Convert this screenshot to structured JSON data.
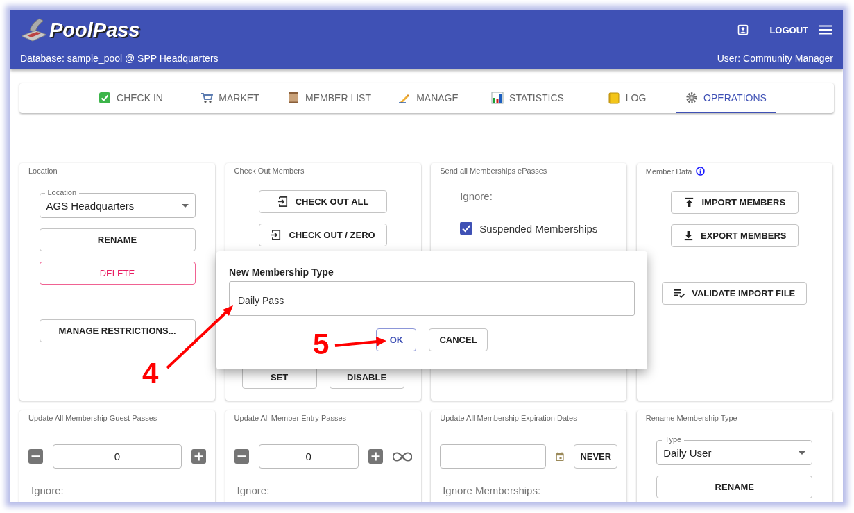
{
  "app": {
    "title": "PoolPass",
    "database": "Database: sample_pool @ SPP Headquarters",
    "user": "User: Community Manager",
    "logout": "LOGOUT"
  },
  "tabs": [
    {
      "label": "CHECK IN",
      "selected": false
    },
    {
      "label": "MARKET",
      "selected": false
    },
    {
      "label": "MEMBER LIST",
      "selected": false
    },
    {
      "label": "MANAGE",
      "selected": false
    },
    {
      "label": "STATISTICS",
      "selected": false
    },
    {
      "label": "LOG",
      "selected": false
    },
    {
      "label": "OPERATIONS",
      "selected": true
    }
  ],
  "cards": [
    {
      "title": "Location",
      "has_info": false,
      "sections": [
        [
          {
            "kind": "select",
            "label": "Location",
            "value": "AGS Headquarters"
          },
          {
            "kind": "button",
            "label": "RENAME"
          },
          {
            "kind": "danger",
            "label": "DELETE"
          }
        ],
        [
          {
            "kind": "button",
            "label": "MANAGE RESTRICTIONS..."
          }
        ]
      ]
    },
    {
      "title": "Check Out Members",
      "has_info": false,
      "sections": [
        [
          {
            "kind": "exit",
            "label": "CHECK OUT ALL"
          },
          {
            "kind": "exit",
            "label": "CHECK OUT / ZERO"
          }
        ],
        [
          {
            "kind": "button-row",
            "buttons": [
              "SET",
              "DISABLE"
            ]
          }
        ]
      ]
    },
    {
      "title": "Send all Memberships ePasses",
      "has_info": false,
      "sections": [
        [
          {
            "kind": "label",
            "text": "Ignore:"
          },
          {
            "kind": "checkbox",
            "label": "Suspended Memberships",
            "checked": true
          }
        ]
      ]
    },
    {
      "title": "Member Data",
      "has_info": true,
      "sections": [
        [
          {
            "kind": "upload",
            "label": "IMPORT MEMBERS"
          },
          {
            "kind": "download",
            "label": "EXPORT MEMBERS"
          }
        ],
        [
          {
            "kind": "validate",
            "label": "VALIDATE IMPORT FILE"
          }
        ]
      ]
    },
    {
      "title": "Update All Membership Guest Passes",
      "has_info": false,
      "sections": [
        [
          {
            "kind": "stepper",
            "value": "0",
            "unlimited": false
          },
          {
            "kind": "label",
            "text": "Ignore:"
          }
        ]
      ]
    },
    {
      "title": "Update All Member Entry Passes",
      "has_info": false,
      "sections": [
        [
          {
            "kind": "stepper",
            "value": "0",
            "unlimited": true
          },
          {
            "kind": "label",
            "text": "Ignore:"
          }
        ]
      ]
    },
    {
      "title": "Update All Membership Expiration Dates",
      "has_info": false,
      "sections": [
        [
          {
            "kind": "date",
            "button": "NEVER"
          },
          {
            "kind": "label",
            "text": "Ignore Memberships:"
          }
        ]
      ]
    },
    {
      "title": "Rename Membership Type",
      "has_info": false,
      "sections": [
        [
          {
            "kind": "select",
            "label": "Type",
            "value": "Daily User"
          },
          {
            "kind": "button",
            "label": "RENAME"
          }
        ]
      ]
    }
  ],
  "dialog": {
    "title": "New Membership Type",
    "value": "Daily Pass",
    "buttons": [
      {
        "label": "OK",
        "focused": true
      },
      {
        "label": "CANCEL",
        "focused": false
      }
    ]
  },
  "annotations": [
    {
      "label": "4"
    },
    {
      "label": "5"
    }
  ]
}
